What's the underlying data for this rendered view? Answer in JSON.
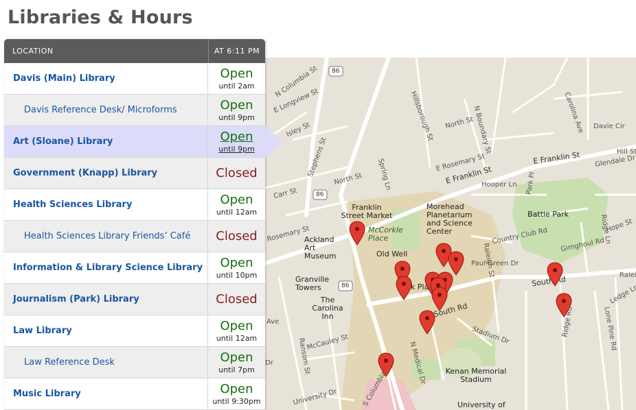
{
  "page": {
    "title": "Libraries & Hours"
  },
  "table": {
    "location_header": "LOCATION",
    "time_header": "AT 6:11 PM",
    "rows": [
      {
        "name": "Davis (Main) Library",
        "status": "Open",
        "until": "until 2am",
        "sub": false
      },
      {
        "name": "Davis Reference Desk/ Microforms",
        "status": "Open",
        "until": "until 9pm",
        "sub": true
      },
      {
        "name": "Art (Sloane) Library",
        "status": "Open",
        "until": "until 9pm",
        "sub": false,
        "selected": true
      },
      {
        "name": "Government (Knapp) Library",
        "status": "Closed",
        "until": "",
        "sub": false
      },
      {
        "name": "Health Sciences Library",
        "status": "Open",
        "until": "until 12am",
        "sub": false
      },
      {
        "name": "Health Sciences Library Friends’ Café",
        "status": "Closed",
        "until": "",
        "sub": true
      },
      {
        "name": "Information & Library Science Library",
        "status": "Open",
        "until": "until 10pm",
        "sub": false
      },
      {
        "name": "Journalism (Park) Library",
        "status": "Closed",
        "until": "",
        "sub": false
      },
      {
        "name": "Law Library",
        "status": "Open",
        "until": "until 12am",
        "sub": false
      },
      {
        "name": "Law Reference Desk",
        "status": "Open",
        "until": "until 7pm",
        "sub": true
      },
      {
        "name": "Music Library",
        "status": "Open",
        "until": "until 9:30pm",
        "sub": false
      }
    ]
  },
  "map": {
    "labels": {
      "columbia_st": "N Columbia St",
      "longview": "E Longview St",
      "isley": "Isley St",
      "stephens": "Stephens St",
      "carr": "Carr St",
      "north_st": "North St",
      "rosemary_w": "Rosemary St",
      "n_rosemary": "E Rosemary St",
      "e_franklin": "E Franklin St",
      "e_franklin2": "E Franklin St",
      "hillsborough": "Hillsborough St",
      "spring": "Spring Ln",
      "north_st2": "North St",
      "n_boundary": "N Boundary St",
      "hooper": "Hooper Ln",
      "park_pl": "Park Pl",
      "franklin_market": "Franklin Street Market",
      "mccorkle": "McCorkle Place",
      "morehead": "Morehead Planetarium and Science Center",
      "ackland": "Ackland Art Museum",
      "old_well": "Old Well",
      "country_club": "Country Club Rd",
      "battle_park": "Battle Park",
      "granville": "Granville Towers",
      "carolina_inn": "The Carolina Inn",
      "polk": "Polk Place",
      "south_rd": "South Rd",
      "south_rd2": "South Rd",
      "paul_green": "Paul Green Dr",
      "raleigh": "Raleigh St",
      "stadium": "Stadium Dr",
      "mccauley": "McCauley St",
      "ransom": "Ransom St",
      "n_medical": "N Medical Dr",
      "s_columbia": "S Columbia St",
      "kenan": "Kenan Memorial Stadium",
      "university": "University Dr",
      "univ_of": "University of",
      "ridge_rd": "Ridge Rd",
      "gimghoul": "Gimghoul Rd",
      "glendale": "Glendale Dr",
      "davie_cir": "Davie Cir",
      "carolina_ave": "Carolina Ave",
      "hill_st": "Hill St",
      "raleigh_rd": "Raleigh Rd",
      "ridge_ln": "Ridge Ln",
      "lone_pine": "Lone Pine Rd",
      "ledge_ln": "Ledge Ln",
      "hope_st": "Hope St",
      "ave": "Ave",
      "dr": "Dr",
      "shield_86a": "86",
      "shield_86b": "86",
      "shield_86c": "86"
    }
  }
}
